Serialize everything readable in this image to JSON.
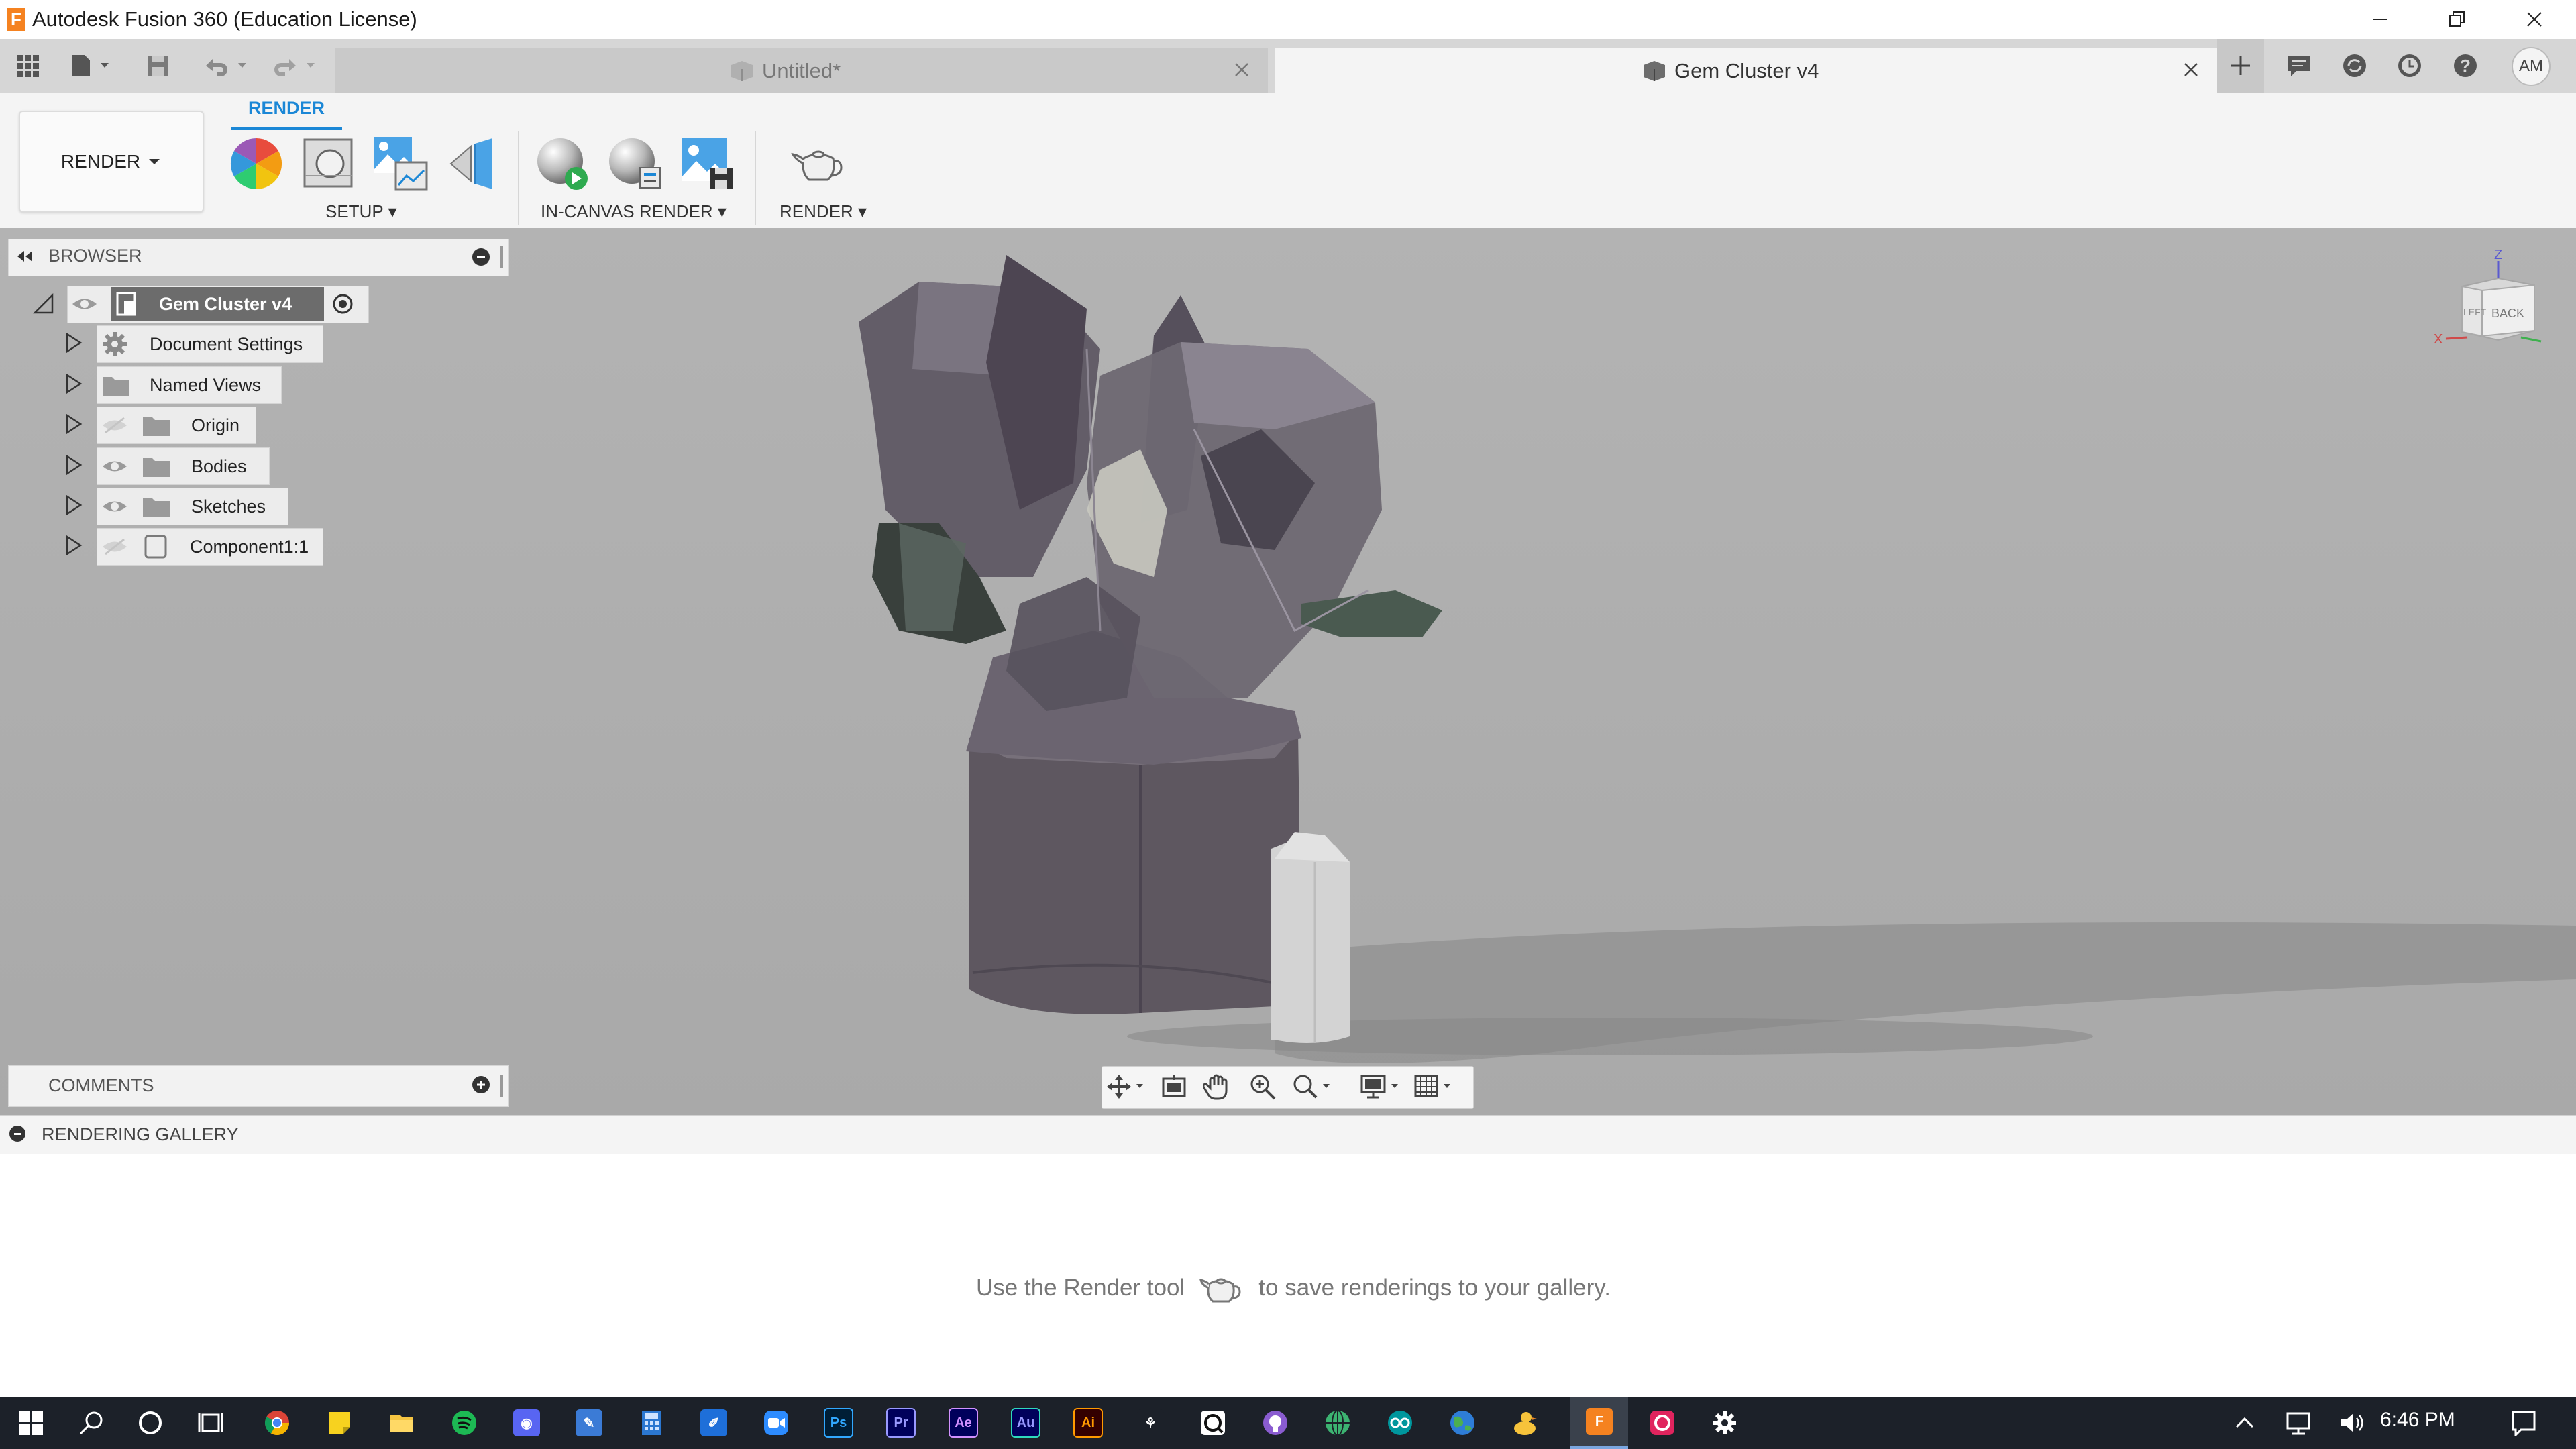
{
  "window": {
    "title": "Autodesk Fusion 360 (Education License)",
    "app_icon_letter": "F"
  },
  "tabs": [
    {
      "label": "Untitled*",
      "active": false
    },
    {
      "label": "Gem Cluster v4",
      "active": true
    }
  ],
  "account": {
    "initials": "AM"
  },
  "ribbon": {
    "workspace": "RENDER",
    "active_tab": "RENDER",
    "groups": [
      {
        "label": "SETUP"
      },
      {
        "label": "IN-CANVAS RENDER"
      },
      {
        "label": "RENDER"
      }
    ]
  },
  "browser": {
    "title": "BROWSER",
    "root": "Gem Cluster v4",
    "items": [
      {
        "label": "Document Settings",
        "icon": "gear-icon",
        "visibility": "none"
      },
      {
        "label": "Named Views",
        "icon": "folder-icon",
        "visibility": "none"
      },
      {
        "label": "Origin",
        "icon": "folder-icon",
        "visibility": "hidden"
      },
      {
        "label": "Bodies",
        "icon": "folder-icon",
        "visibility": "visible"
      },
      {
        "label": "Sketches",
        "icon": "folder-icon",
        "visibility": "visible"
      },
      {
        "label": "Component1:1",
        "icon": "component-icon",
        "visibility": "hidden"
      }
    ]
  },
  "viewcube": {
    "face_back": "BACK",
    "face_left": "LEFT",
    "axis_z": "Z",
    "axis_x": "X"
  },
  "comments": {
    "title": "COMMENTS"
  },
  "gallery": {
    "title": "RENDERING GALLERY",
    "hint_before": "Use the Render tool",
    "hint_after": "to save renderings to your gallery."
  },
  "taskbar": {
    "time": "6:46 PM",
    "apps": [
      "Chrome",
      "Sticky Notes",
      "File Explorer",
      "Spotify",
      "Discord",
      "Paint 3D",
      "Calculator",
      "Sketchbook",
      "Zoom",
      "Photoshop",
      "Premiere Pro",
      "After Effects",
      "Audition",
      "Illustrator",
      "Acrobat",
      "Camera",
      "GitHub",
      "Web",
      "Arduino",
      "Browser",
      "Duck",
      "Fusion 360",
      "Creative Cloud",
      "Settings"
    ]
  },
  "colors": {
    "accent": "#1b87d6",
    "viewport": "#b0b0b0",
    "taskbar": "#1c2129"
  }
}
